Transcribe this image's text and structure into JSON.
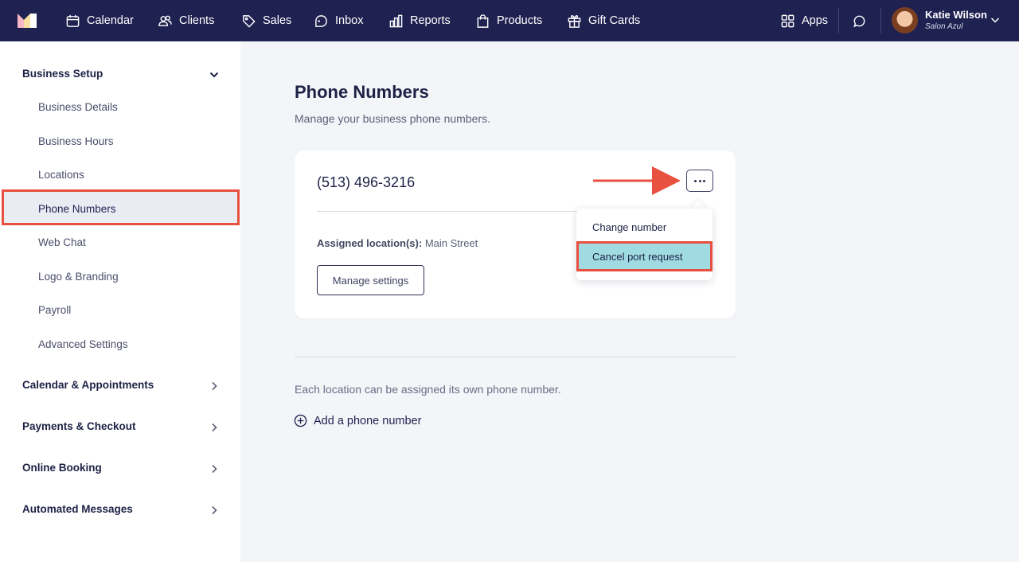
{
  "topnav": {
    "items": [
      {
        "label": "Calendar",
        "icon": "calendar-icon"
      },
      {
        "label": "Clients",
        "icon": "clients-icon"
      },
      {
        "label": "Sales",
        "icon": "tag-icon"
      },
      {
        "label": "Inbox",
        "icon": "inbox-icon"
      },
      {
        "label": "Reports",
        "icon": "bar-chart-icon"
      },
      {
        "label": "Products",
        "icon": "shopping-bag-icon"
      },
      {
        "label": "Gift Cards",
        "icon": "gift-icon"
      }
    ],
    "apps_label": "Apps",
    "user": {
      "name": "Katie Wilson",
      "business": "Salon Azul"
    }
  },
  "sidebar": {
    "business_setup": {
      "title": "Business Setup",
      "items": [
        "Business Details",
        "Business Hours",
        "Locations",
        "Phone Numbers",
        "Web Chat",
        "Logo & Branding",
        "Payroll",
        "Advanced Settings"
      ],
      "active": "Phone Numbers"
    },
    "sections": [
      "Calendar & Appointments",
      "Payments & Checkout",
      "Online Booking",
      "Automated Messages"
    ]
  },
  "main": {
    "title": "Phone Numbers",
    "subtitle": "Manage your business phone numbers.",
    "card": {
      "phone": "(513) 496-3216",
      "assigned_label": "Assigned location(s):",
      "assigned_value": "Main Street",
      "manage_button": "Manage settings"
    },
    "menu": {
      "items": [
        "Change number",
        "Cancel port request"
      ],
      "highlighted": "Cancel port request"
    },
    "hint": "Each location can be assigned its own phone number.",
    "add_link": "Add a phone number"
  },
  "colors": {
    "nav_bg": "#1f2151",
    "highlight": "#e8503f",
    "menu_highlight": "#9fdbe1",
    "page_bg": "#f4f5f8"
  }
}
